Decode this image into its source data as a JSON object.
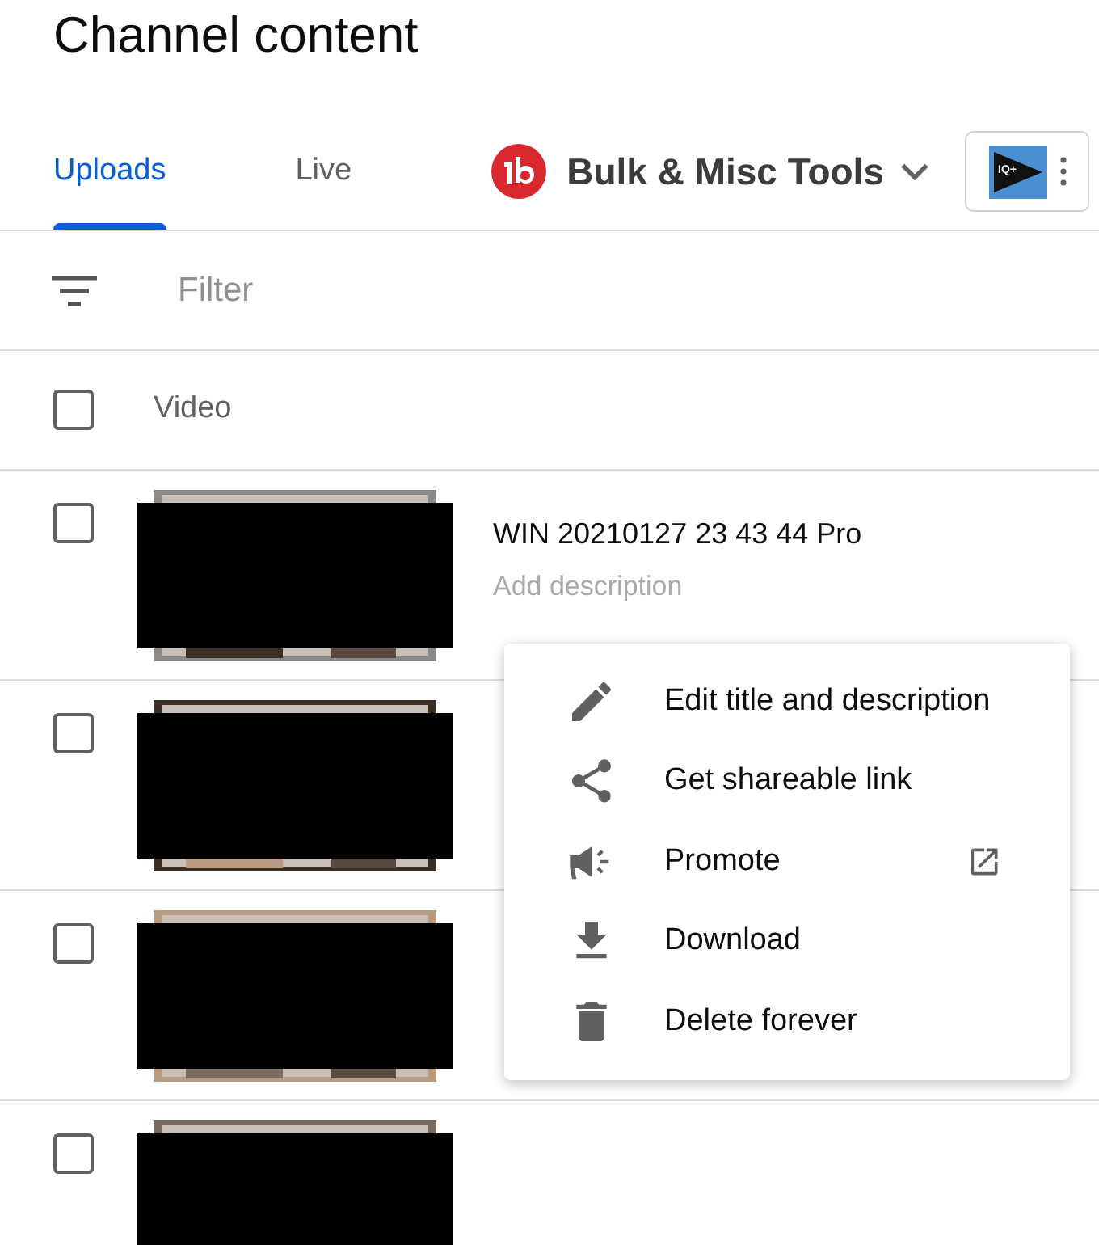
{
  "page_title": "Channel content",
  "tabs": [
    {
      "label": "Uploads",
      "selected": true
    },
    {
      "label": "Live",
      "selected": false
    }
  ],
  "extension": {
    "name": "Bulk & Misc Tools",
    "logo_text": "IQ+"
  },
  "filter": {
    "placeholder": "Filter"
  },
  "table": {
    "header": {
      "label": "Video",
      "checked": false
    },
    "rows": [
      {
        "title": "WIN 20210127 23 43 44 Pro",
        "description": "Add description",
        "checked": false
      },
      {
        "checked": false
      },
      {
        "checked": false
      },
      {
        "checked": false
      }
    ]
  },
  "menu": [
    {
      "kind": "edit",
      "label": "Edit title and description"
    },
    {
      "kind": "share",
      "label": "Get shareable link"
    },
    {
      "kind": "promote",
      "label": "Promote",
      "external": true
    },
    {
      "kind": "download",
      "label": "Download"
    },
    {
      "kind": "delete",
      "label": "Delete forever"
    }
  ]
}
